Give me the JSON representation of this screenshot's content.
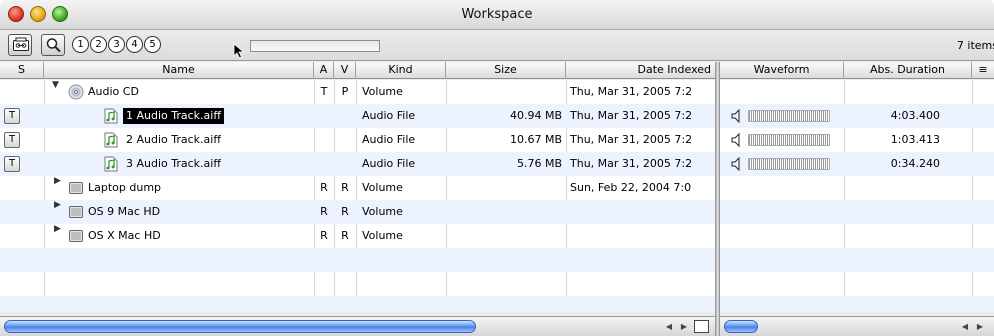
{
  "window": {
    "title": "Workspace"
  },
  "toolbar": {
    "circle_buttons": [
      "1",
      "2",
      "3",
      "4",
      "5"
    ],
    "item_count": "7 items"
  },
  "columns": {
    "s": "S",
    "name": "Name",
    "a": "A",
    "v": "V",
    "kind": "Kind",
    "size": "Size",
    "date": "Date Indexed",
    "waveform": "Waveform",
    "duration": "Abs. Duration"
  },
  "rows": [
    {
      "s": "",
      "name": "Audio CD",
      "a": "T",
      "v": "P",
      "kind": "Volume",
      "size": "",
      "date": "Thu, Mar 31, 2005 7:2",
      "duration": "",
      "icon": "cd-icon",
      "expanded": true,
      "indent": 0
    },
    {
      "s": "T",
      "name": "1 Audio Track.aiff",
      "a": "",
      "v": "",
      "kind": "Audio File",
      "size": "40.94 MB",
      "date": "Thu, Mar 31, 2005 7:2",
      "duration": "4:03.400",
      "icon": "audio-file-icon",
      "selected": true,
      "indent": 1
    },
    {
      "s": "T",
      "name": "2 Audio Track.aiff",
      "a": "",
      "v": "",
      "kind": "Audio File",
      "size": "10.67 MB",
      "date": "Thu, Mar 31, 2005 7:2",
      "duration": "1:03.413",
      "icon": "audio-file-icon",
      "indent": 1
    },
    {
      "s": "T",
      "name": "3 Audio Track.aiff",
      "a": "",
      "v": "",
      "kind": "Audio File",
      "size": "5.76 MB",
      "date": "Thu, Mar 31, 2005 7:2",
      "duration": "0:34.240",
      "icon": "audio-file-icon",
      "indent": 1
    },
    {
      "s": "",
      "name": "Laptop dump",
      "a": "R",
      "v": "R",
      "kind": "Volume",
      "size": "",
      "date": "Sun, Feb 22, 2004 7:0",
      "duration": "",
      "icon": "hard-drive-icon",
      "indent": 0
    },
    {
      "s": "",
      "name": "OS 9 Mac HD",
      "a": "R",
      "v": "R",
      "kind": "Volume",
      "size": "",
      "date": "",
      "duration": "",
      "icon": "hard-drive-icon",
      "indent": 0
    },
    {
      "s": "",
      "name": "OS X Mac HD",
      "a": "R",
      "v": "R",
      "kind": "Volume",
      "size": "",
      "date": "",
      "duration": "",
      "icon": "hard-drive-icon",
      "indent": 0
    }
  ]
}
